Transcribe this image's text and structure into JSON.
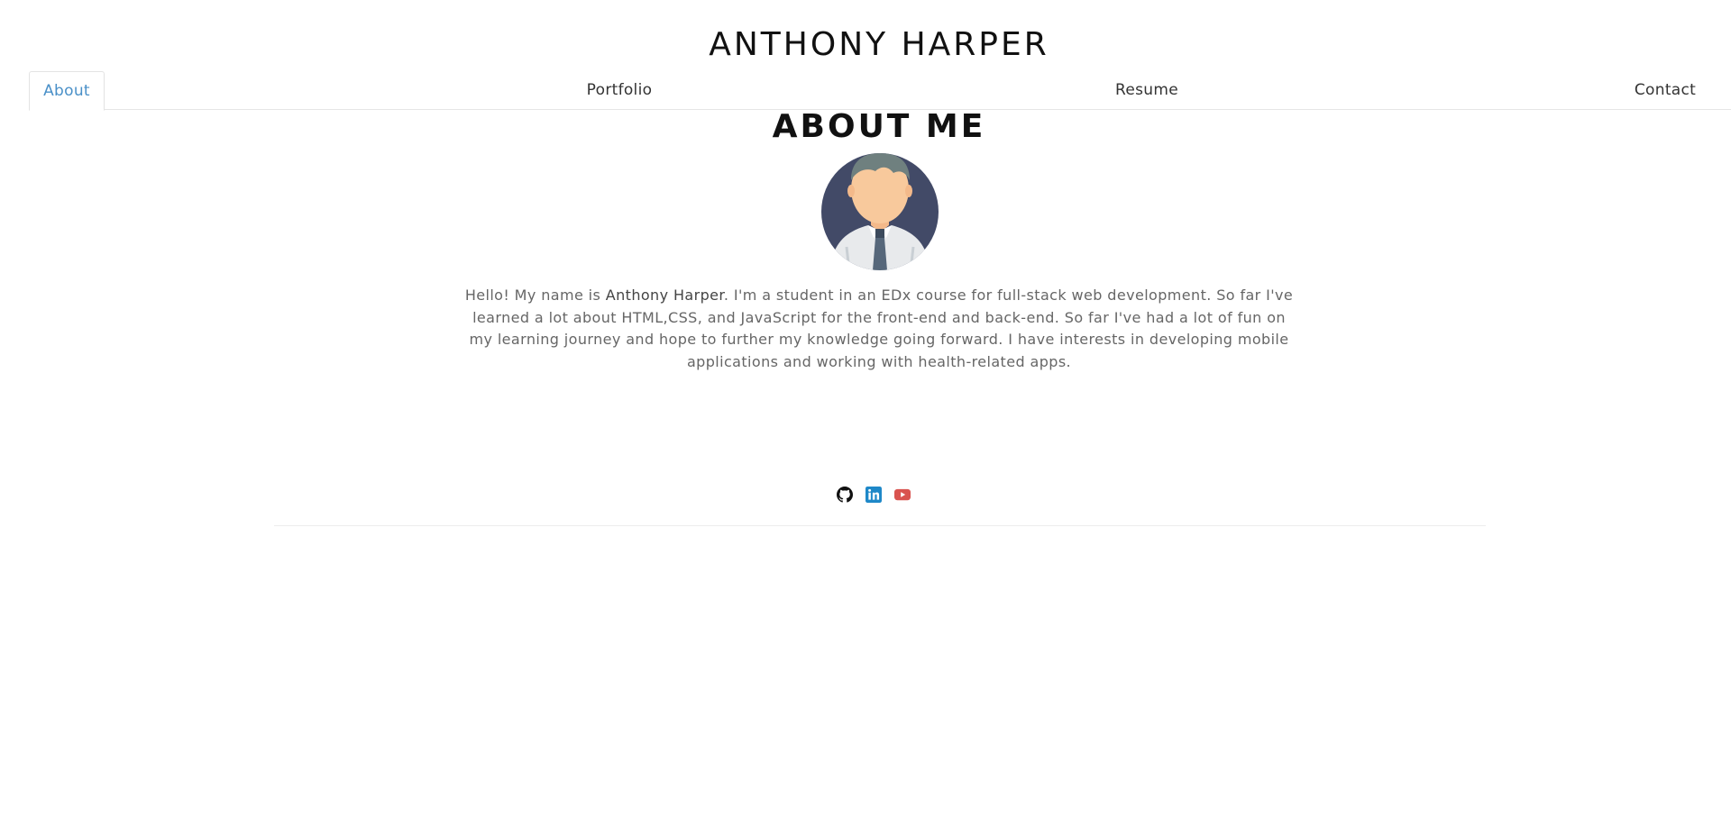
{
  "header": {
    "title": "ANTHONY HARPER"
  },
  "nav": {
    "tabs": [
      {
        "label": "About",
        "active": true
      },
      {
        "label": "Portfolio",
        "active": false
      },
      {
        "label": "Resume",
        "active": false
      },
      {
        "label": "Contact",
        "active": false
      }
    ]
  },
  "about": {
    "heading": "ABOUT ME",
    "bio_prefix": "Hello! My name is ",
    "bio_name": "Anthony Harper",
    "bio_suffix": ". I'm a student in an EDx course for full-stack web development. So far I've learned a lot about HTML,CSS, and JavaScript for the front-end and back-end. So far I've had a lot of fun on my learning journey and hope to further my knowledge going forward. I have interests in developing mobile applications and working with health-related apps."
  },
  "socials": [
    {
      "icon": "github-icon",
      "color": "#111111"
    },
    {
      "icon": "linkedin-icon",
      "color": "#1e88c8"
    },
    {
      "icon": "youtube-icon",
      "color": "#d9534f"
    }
  ],
  "colors": {
    "active_tab": "#4a90c8",
    "title": "#111111",
    "body_text": "#666666"
  }
}
